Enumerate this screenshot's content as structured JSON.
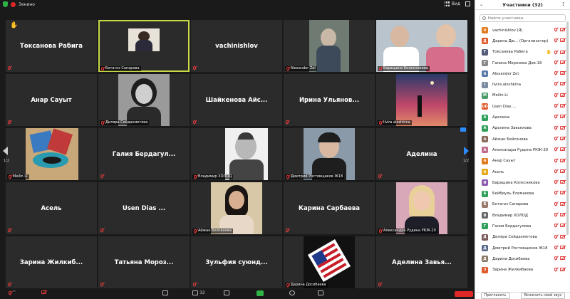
{
  "topbar": {
    "left_label": "Зенино",
    "view_label": "Вид"
  },
  "panel": {
    "title": "Участники (32)",
    "search_placeholder": "Найти участника",
    "invite_label": "Пригласить",
    "unmute_label": "Включить свой звук",
    "participants": [
      {
        "name": "vachinishlov (Я)",
        "initial": "V",
        "color": "#e07b1f"
      },
      {
        "name": "Дарина Дю...  (Организатор)",
        "initial": "Д",
        "color": "#e05a2b"
      },
      {
        "name": "Токсанова Рабига",
        "initial": "Т",
        "color": "#555c7a",
        "hand": true
      },
      {
        "name": "Галина Морозова Дов-18",
        "initial": "Г",
        "color": "#8a8a8a"
      },
      {
        "name": "Alexander Zel",
        "initial": "A",
        "color": "#5a7aa8"
      },
      {
        "name": "Ilvira aleshkina",
        "initial": "I",
        "color": "#7a8aa0"
      },
      {
        "name": "Meilin Li",
        "initial": "M",
        "color": "#4a9a6a"
      },
      {
        "name": "Usen Dias ...",
        "initial": "UD",
        "color": "#e05a2b"
      },
      {
        "name": "Аделина",
        "initial": "А",
        "color": "#2fa05a"
      },
      {
        "name": "Аделина Завьялова",
        "initial": "А",
        "color": "#2fa05a"
      },
      {
        "name": "Айжан Бейсенова",
        "initial": "А",
        "color": "#8a6a5a"
      },
      {
        "name": "Александра Рудина РКЖ-20",
        "initial": "А",
        "color": "#c06a8a"
      },
      {
        "name": "Анар Сауыт",
        "initial": "А",
        "color": "#e07b1f"
      },
      {
        "name": "Асель",
        "initial": "А",
        "color": "#e6a817"
      },
      {
        "name": "Баращина Колесникова",
        "initial": "И",
        "color": "#8a5ab0"
      },
      {
        "name": "Бейбиуль Елемакова",
        "initial": "Б",
        "color": "#2fa05a"
      },
      {
        "name": "Ботагоз Сапарова",
        "initial": "Б",
        "color": "#9a7a6a"
      },
      {
        "name": "Владимир ХОЛОД",
        "initial": "В",
        "color": "#6a6a6a"
      },
      {
        "name": "Галия Бердагулова",
        "initial": "Г",
        "color": "#2fa05a"
      },
      {
        "name": "Диляра Сейдахметова",
        "initial": "Д",
        "color": "#7a5a5a"
      },
      {
        "name": "Дмитрий Ростовщиков Ж18",
        "initial": "Д",
        "color": "#5a6a8a"
      },
      {
        "name": "Дарина Досибаева",
        "initial": "Д",
        "color": "#8a7a6a"
      },
      {
        "name": "Зарина Жилкибаева",
        "initial": "З",
        "color": "#e05a2b"
      }
    ]
  },
  "grid": {
    "page_left": "1/2",
    "page_right": "1/2",
    "tiles": [
      {
        "name": "Токсанова Рабига",
        "caption": ""
      },
      {
        "name": "",
        "caption": "Ботагоз Сапарова"
      },
      {
        "name": "vachinishlov",
        "caption": ""
      },
      {
        "name": "",
        "caption": "Alexander Zel"
      },
      {
        "name": "",
        "caption": "Баращина Колесникова"
      },
      {
        "name": "Анар Сауыт",
        "caption": ""
      },
      {
        "name": "",
        "caption": "Диляра Сейдахметова"
      },
      {
        "name": "Шайкенова Айс...",
        "caption": ""
      },
      {
        "name": "Ирина Ульянов...",
        "caption": ""
      },
      {
        "name": "",
        "caption": "Ilvira aleshkina"
      },
      {
        "name": "",
        "caption": "Meilin Li"
      },
      {
        "name": "Галия Бердагул...",
        "caption": ""
      },
      {
        "name": "",
        "caption": "Владимир ХОЛОД"
      },
      {
        "name": "",
        "caption": "Дмитрий Ростовщиков Ж18"
      },
      {
        "name": "Аделина",
        "caption": ""
      },
      {
        "name": "Асель",
        "caption": ""
      },
      {
        "name": "Usen Dias ...",
        "caption": ""
      },
      {
        "name": "",
        "caption": "Айжан Бейсенова"
      },
      {
        "name": "Карина Сарбаева",
        "caption": ""
      },
      {
        "name": "",
        "caption": "Александра Рудина РКЖ-20"
      },
      {
        "name": "Зарина Жилкиб...",
        "caption": ""
      },
      {
        "name": "Татьяна Мороз...",
        "caption": ""
      },
      {
        "name": "Зульфия суюнд...",
        "caption": ""
      },
      {
        "name": "",
        "caption": "Дарина Досибаева"
      },
      {
        "name": "Аделина Завья...",
        "caption": ""
      }
    ]
  },
  "toolbar": {
    "participants_count": "32"
  }
}
